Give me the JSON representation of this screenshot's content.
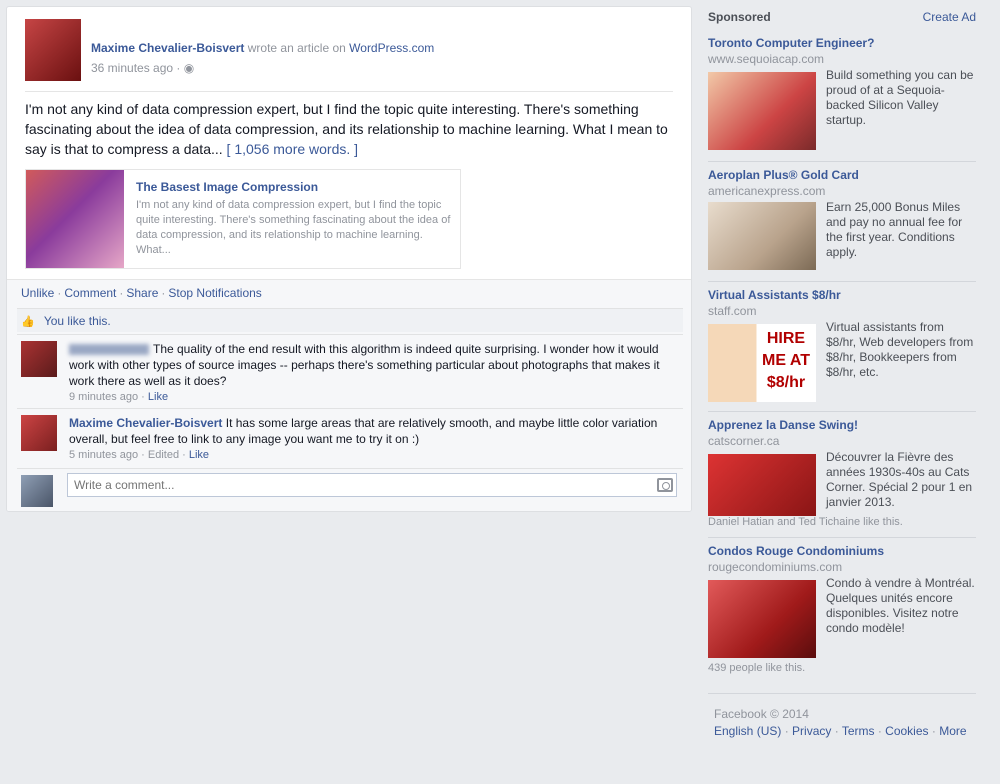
{
  "story": {
    "author": "Maxime Chevalier-Boisvert",
    "action_text": "wrote an article on",
    "site": "WordPress.com",
    "time": "36 minutes ago",
    "body": "I'm not any kind of data compression expert, but I find the topic quite interesting. There's something fascinating about the idea of data compression, and its relationship to machine learning. What I mean to say is that to compress a data",
    "see_more": "...",
    "more_words": "[ 1,056 more words. ]",
    "attachment": {
      "title": "The Basest Image Compression",
      "description": "I'm not any kind of data compression expert, but I find the topic quite interesting. There's something fascinating about the idea of data compression, and its relationship to machine learning. What..."
    },
    "actions": {
      "like": "Unlike",
      "comment": "Comment",
      "share": "Share",
      "notifications": "Stop Notifications"
    },
    "likes_text": "You like this."
  },
  "comments": [
    {
      "author": "",
      "text": "The quality of the end result with this algorithm is indeed quite surprising. I wonder how it would work with other types of source images -- perhaps there's something particular about photographs that makes it work there as well as it does?",
      "time": "9 minutes ago",
      "like": "Like"
    },
    {
      "author": "Maxime Chevalier-Boisvert",
      "text": "It has some large areas that are relatively smooth, and maybe little color variation overall, but feel free to link to any image you want me to try it on :)",
      "time": "5 minutes ago",
      "edited": "Edited",
      "like": "Like"
    }
  ],
  "write_comment": {
    "placeholder": "Write a comment..."
  },
  "sidebar": {
    "heading": "Sponsored",
    "create_ad": "Create Ad",
    "ads": [
      {
        "title": "Toronto Computer Engineer?",
        "domain": "www.sequoiacap.com",
        "text": "Build something you can be proud of at a Sequoia-backed Silicon Valley startup."
      },
      {
        "title": "Aeroplan Plus® Gold Card",
        "domain": "americanexpress.com",
        "text": "Earn 25,000 Bonus Miles and pay no annual fee for the first year. Conditions apply."
      },
      {
        "title": "Virtual Assistants $8/hr",
        "domain": "staff.com",
        "text": "Virtual assistants from $8/hr, Web developers from $8/hr, Bookkeepers from $8/hr, etc.",
        "img_text": "HIRE ME AT $8/hr"
      },
      {
        "title": "Apprenez la Danse Swing!",
        "domain": "catscorner.ca",
        "text": "Découvrer la Fièvre des années 1930s-40s au Cats Corner. Spécial 2 pour 1 en janvier 2013.",
        "social": "Daniel Hatian and Ted Tichaine like this."
      },
      {
        "title": "Condos Rouge Condominiums",
        "domain": "rougecondominiums.com",
        "text": "Condo à vendre à Montréal. Quelques unités encore disponibles. Visitez notre condo modèle!",
        "social": "439 people like this."
      }
    ]
  },
  "footer": {
    "copyright": "Facebook © 2014",
    "links": [
      "English (US)",
      "Privacy",
      "Terms",
      "Cookies",
      "More"
    ]
  },
  "colors": {
    "link": "#3b5998",
    "page_bg": "#e9ebee",
    "muted": "#90949c"
  }
}
